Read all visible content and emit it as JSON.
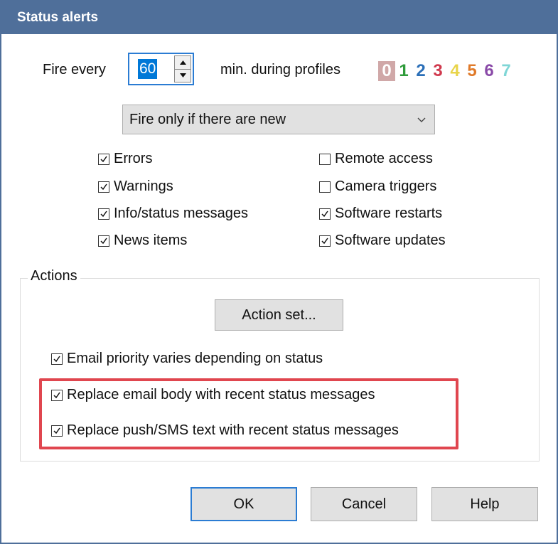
{
  "window": {
    "title": "Status alerts"
  },
  "fire": {
    "label": "Fire every",
    "value": "60",
    "suffix": "min. during profiles"
  },
  "profiles": [
    "0",
    "1",
    "2",
    "3",
    "4",
    "5",
    "6",
    "7"
  ],
  "profile_colors": [
    "#ffffff",
    "#2e9b3a",
    "#2b6fb8",
    "#d0394d",
    "#e8d44a",
    "#e07a2a",
    "#8a4aa8",
    "#7fd6d6"
  ],
  "condition": {
    "selected": "Fire only if there are new"
  },
  "checks_left": [
    {
      "label": "Errors",
      "checked": true
    },
    {
      "label": "Warnings",
      "checked": true
    },
    {
      "label": "Info/status messages",
      "checked": true
    },
    {
      "label": "News items",
      "checked": true
    }
  ],
  "checks_right": [
    {
      "label": "Remote access",
      "checked": false
    },
    {
      "label": "Camera triggers",
      "checked": false
    },
    {
      "label": "Software restarts",
      "checked": true
    },
    {
      "label": "Software updates",
      "checked": true
    }
  ],
  "actions": {
    "group_label": "Actions",
    "action_set_label": "Action set...",
    "options": [
      {
        "label": "Email priority varies depending on status",
        "checked": true
      },
      {
        "label": "Replace email body with recent status messages",
        "checked": true
      },
      {
        "label": "Replace push/SMS text with recent status messages",
        "checked": true
      }
    ]
  },
  "buttons": {
    "ok": "OK",
    "cancel": "Cancel",
    "help": "Help"
  },
  "colors": {
    "titlebar": "#4f6f9a",
    "accent": "#2b7cd3",
    "highlight": "#e0464f"
  }
}
